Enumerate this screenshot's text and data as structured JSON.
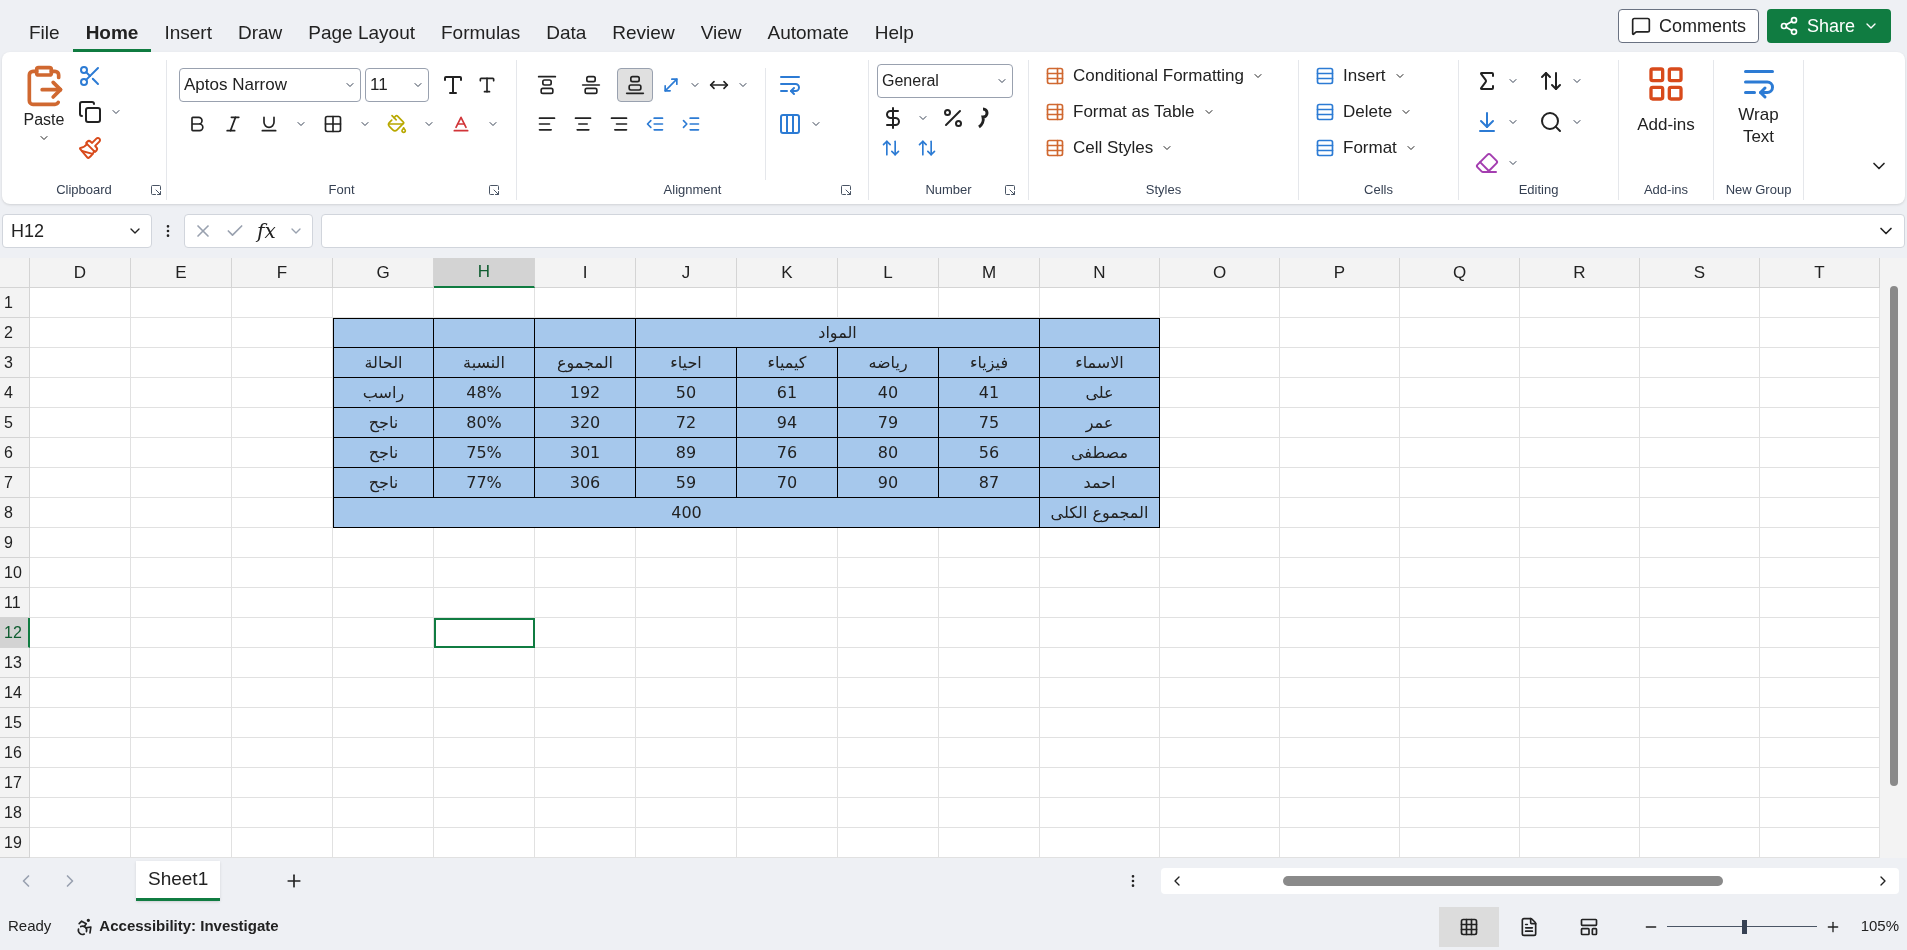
{
  "menu_tabs": [
    {
      "label": "File",
      "selected": false
    },
    {
      "label": "Home",
      "selected": true
    },
    {
      "label": "Insert",
      "selected": false
    },
    {
      "label": "Draw",
      "selected": false
    },
    {
      "label": "Page Layout",
      "selected": false
    },
    {
      "label": "Formulas",
      "selected": false
    },
    {
      "label": "Data",
      "selected": false
    },
    {
      "label": "Review",
      "selected": false
    },
    {
      "label": "View",
      "selected": false
    },
    {
      "label": "Automate",
      "selected": false
    },
    {
      "label": "Help",
      "selected": false
    }
  ],
  "top_buttons": {
    "comments": "Comments",
    "share": "Share"
  },
  "ribbon": {
    "clipboard": {
      "paste": "Paste",
      "label": "Clipboard"
    },
    "font": {
      "font_name": "Aptos Narrow",
      "font_size": "11",
      "label": "Font"
    },
    "alignment": {
      "label": "Alignment",
      "vertical": [
        {
          "kind": "top",
          "selected": false
        },
        {
          "kind": "middle",
          "selected": false
        },
        {
          "kind": "bottom",
          "selected": true
        }
      ]
    },
    "number": {
      "format": "General",
      "label": "Number"
    },
    "styles": {
      "items": [
        "Conditional Formatting",
        "Format as Table",
        "Cell Styles"
      ],
      "label": "Styles"
    },
    "cells": {
      "items": [
        "Insert",
        "Delete",
        "Format"
      ],
      "label": "Cells"
    },
    "editing": {
      "label": "Editing"
    },
    "addins": {
      "button": "Add-ins",
      "label": "Add-ins"
    },
    "new_group": {
      "button_line1": "Wrap",
      "button_line2": "Text",
      "label": "New Group"
    }
  },
  "formula_bar": {
    "name_box": "H12",
    "function_label": "fx"
  },
  "sheet": {
    "columns": [
      {
        "label": "D",
        "selected": false
      },
      {
        "label": "E",
        "selected": false
      },
      {
        "label": "F",
        "selected": false
      },
      {
        "label": "G",
        "selected": false
      },
      {
        "label": "H",
        "selected": true
      },
      {
        "label": "I",
        "selected": false
      },
      {
        "label": "J",
        "selected": false
      },
      {
        "label": "K",
        "selected": false
      },
      {
        "label": "L",
        "selected": false
      },
      {
        "label": "M",
        "selected": false
      },
      {
        "label": "N",
        "selected": false
      },
      {
        "label": "O",
        "selected": false
      },
      {
        "label": "P",
        "selected": false
      },
      {
        "label": "Q",
        "selected": false
      },
      {
        "label": "R",
        "selected": false
      },
      {
        "label": "S",
        "selected": false
      },
      {
        "label": "T",
        "selected": false
      }
    ],
    "rows": [
      {
        "label": "1",
        "selected": false
      },
      {
        "label": "2",
        "selected": false
      },
      {
        "label": "3",
        "selected": false
      },
      {
        "label": "4",
        "selected": false
      },
      {
        "label": "5",
        "selected": false
      },
      {
        "label": "6",
        "selected": false
      },
      {
        "label": "7",
        "selected": false
      },
      {
        "label": "8",
        "selected": false
      },
      {
        "label": "9",
        "selected": false
      },
      {
        "label": "10",
        "selected": false
      },
      {
        "label": "11",
        "selected": false
      },
      {
        "label": "12",
        "selected": true
      },
      {
        "label": "13",
        "selected": false
      },
      {
        "label": "14",
        "selected": false
      },
      {
        "label": "15",
        "selected": false
      },
      {
        "label": "16",
        "selected": false
      },
      {
        "label": "17",
        "selected": false
      },
      {
        "label": "18",
        "selected": false
      },
      {
        "label": "19",
        "selected": false
      }
    ]
  },
  "table": {
    "rows": [
      [
        {
          "kind": "cell"
        },
        {
          "kind": "cell"
        },
        {
          "kind": "cell"
        },
        {
          "kind": "merged_start",
          "text": "المواد"
        },
        {
          "kind": "merged"
        },
        {
          "kind": "merged"
        },
        {
          "kind": "merged"
        },
        {
          "kind": "cell"
        }
      ],
      [
        {
          "kind": "cell",
          "text": "الحالة"
        },
        {
          "kind": "cell",
          "text": "النسبة"
        },
        {
          "kind": "cell",
          "text": "المجموع"
        },
        {
          "kind": "cell",
          "text": "احياء"
        },
        {
          "kind": "cell",
          "text": "كيمياء"
        },
        {
          "kind": "cell",
          "text": "رياضه"
        },
        {
          "kind": "cell",
          "text": "فيزياء"
        },
        {
          "kind": "cell",
          "text": "الاسماء"
        }
      ],
      [
        {
          "kind": "cell",
          "text": "راسب"
        },
        {
          "kind": "cell",
          "text": "48%"
        },
        {
          "kind": "cell",
          "text": "192"
        },
        {
          "kind": "cell",
          "text": "50"
        },
        {
          "kind": "cell",
          "text": "61"
        },
        {
          "kind": "cell",
          "text": "40"
        },
        {
          "kind": "cell",
          "text": "41"
        },
        {
          "kind": "cell",
          "text": "على"
        }
      ],
      [
        {
          "kind": "cell",
          "text": "ناجح"
        },
        {
          "kind": "cell",
          "text": "80%"
        },
        {
          "kind": "cell",
          "text": "320"
        },
        {
          "kind": "cell",
          "text": "72"
        },
        {
          "kind": "cell",
          "text": "94"
        },
        {
          "kind": "cell",
          "text": "79"
        },
        {
          "kind": "cell",
          "text": "75"
        },
        {
          "kind": "cell",
          "text": "عمر"
        }
      ],
      [
        {
          "kind": "cell",
          "text": "ناجح"
        },
        {
          "kind": "cell",
          "text": "75%"
        },
        {
          "kind": "cell",
          "text": "301"
        },
        {
          "kind": "cell",
          "text": "89"
        },
        {
          "kind": "cell",
          "text": "76"
        },
        {
          "kind": "cell",
          "text": "80"
        },
        {
          "kind": "cell",
          "text": "56"
        },
        {
          "kind": "cell",
          "text": "مصطفى"
        }
      ],
      [
        {
          "kind": "cell",
          "text": "ناجح"
        },
        {
          "kind": "cell",
          "text": "77%"
        },
        {
          "kind": "cell",
          "text": "306"
        },
        {
          "kind": "cell",
          "text": "59"
        },
        {
          "kind": "cell",
          "text": "70"
        },
        {
          "kind": "cell",
          "text": "90"
        },
        {
          "kind": "cell",
          "text": "87"
        },
        {
          "kind": "cell",
          "text": "احمد"
        }
      ],
      [
        {
          "kind": "merged_start"
        },
        {
          "kind": "merged"
        },
        {
          "kind": "merged"
        },
        {
          "kind": "merged",
          "text": "400"
        },
        {
          "kind": "merged"
        },
        {
          "kind": "merged"
        },
        {
          "kind": "merged"
        },
        {
          "kind": "cell",
          "text": "المجموع الكلى"
        }
      ]
    ]
  },
  "sheet_tabs": [
    {
      "label": "Sheet1",
      "selected": true
    }
  ],
  "status_bar": {
    "status": "Ready",
    "accessibility": "Accessibility: Investigate",
    "views": [
      {
        "kind": "normal",
        "selected": true
      },
      {
        "kind": "page_layout",
        "selected": false
      },
      {
        "kind": "page_break",
        "selected": false
      }
    ],
    "zoom": {
      "level": 0.51,
      "reading": "105%"
    }
  }
}
